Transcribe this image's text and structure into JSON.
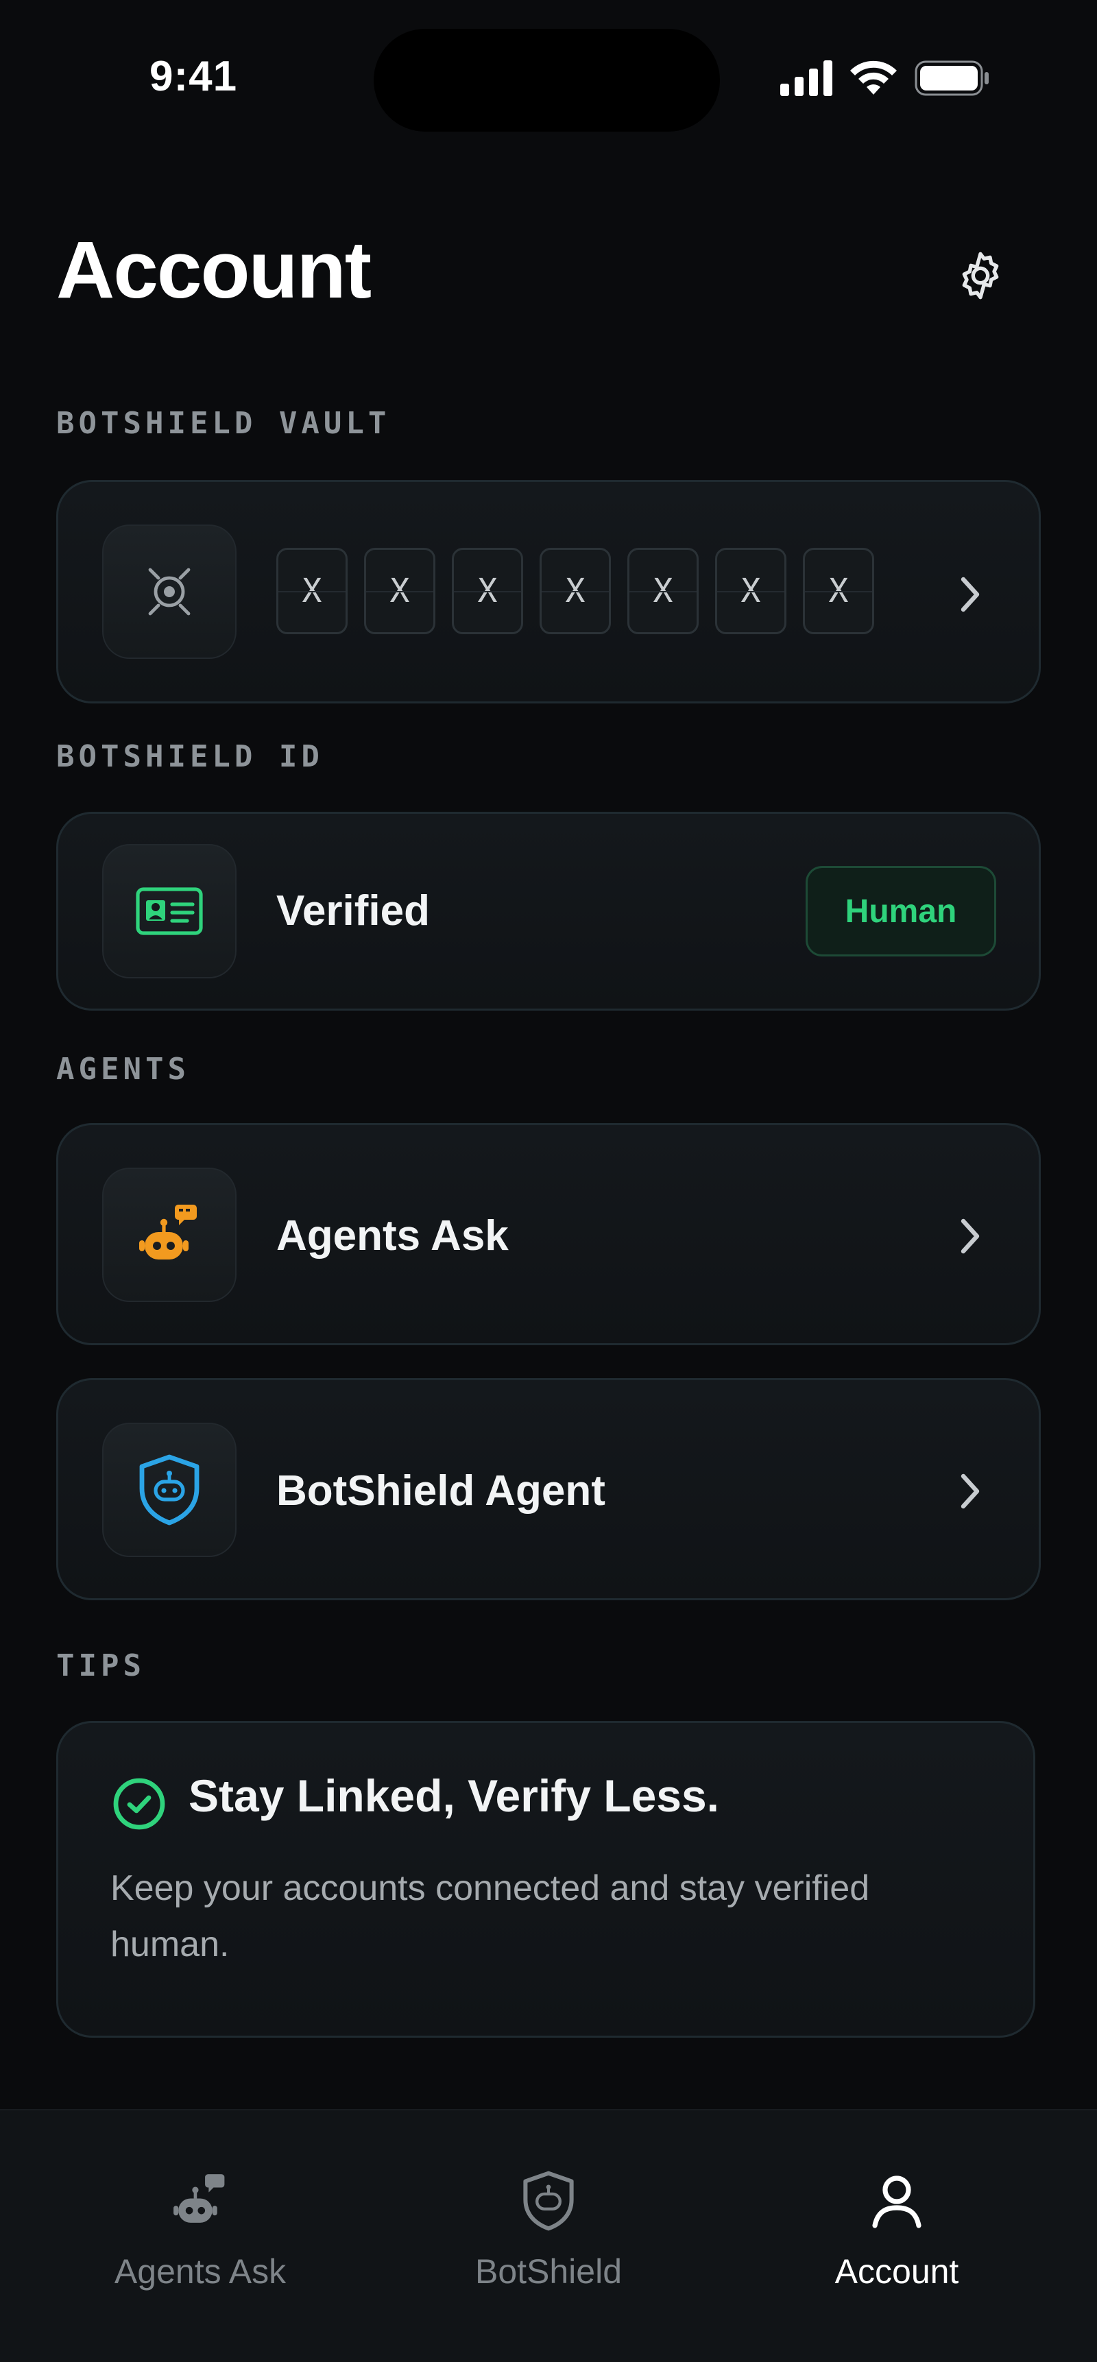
{
  "status_bar": {
    "time": "9:41"
  },
  "header": {
    "title": "Account",
    "settings_icon": "gear-icon"
  },
  "sections": {
    "vault": {
      "label": "BOTSHIELD VAULT",
      "icon": "vault-icon",
      "pin": [
        "X",
        "X",
        "X",
        "X",
        "X",
        "X",
        "X"
      ]
    },
    "id": {
      "label": "BOTSHIELD ID",
      "icon": "id-card-icon",
      "status": "Verified",
      "badge": "Human"
    },
    "agents": {
      "label": "AGENTS",
      "items": [
        {
          "label": "Agents Ask",
          "icon": "robot-chat-icon"
        },
        {
          "label": "BotShield Agent",
          "icon": "shield-robot-icon"
        }
      ]
    },
    "tips": {
      "label": "TIPS",
      "title": "Stay Linked, Verify Less.",
      "body": "Keep your accounts connected and stay verified human."
    }
  },
  "tab_bar": {
    "tabs": [
      {
        "label": "Agents Ask",
        "icon": "robot-chat-icon",
        "active": false
      },
      {
        "label": "BotShield",
        "icon": "shield-icon",
        "active": false
      },
      {
        "label": "Account",
        "icon": "user-icon",
        "active": true
      }
    ]
  },
  "colors": {
    "background": "#0a0b0d",
    "accent_green": "#2fd37c",
    "accent_orange": "#f29a1f",
    "accent_blue": "#2ba4e6"
  }
}
